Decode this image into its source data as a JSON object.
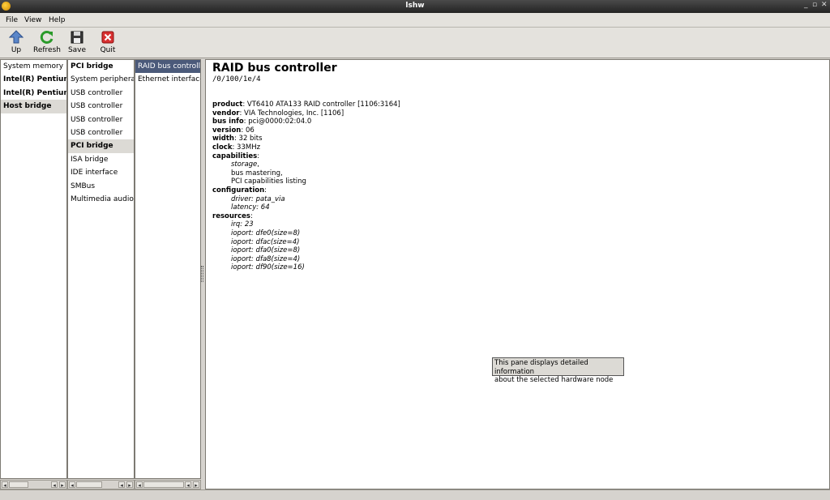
{
  "window": {
    "title": "lshw",
    "controls": [
      "_",
      "▫",
      "✕"
    ]
  },
  "menu": {
    "file": "File",
    "view": "View",
    "help": "Help"
  },
  "toolbar": {
    "up": "Up",
    "refresh": "Refresh",
    "save": "Save",
    "quit": "Quit",
    "icons": {
      "up": "up-arrow-icon",
      "refresh": "refresh-icon",
      "save": "floppy-icon",
      "quit": "quit-icon"
    }
  },
  "columns": [
    {
      "items": [
        {
          "label": "System memory",
          "bold": false,
          "state": ""
        },
        {
          "label": "Intel(R) Pentium",
          "bold": true,
          "state": ""
        },
        {
          "label": "Intel(R) Pentium",
          "bold": true,
          "state": ""
        },
        {
          "label": "Host bridge",
          "bold": true,
          "state": "sel"
        }
      ]
    },
    {
      "items": [
        {
          "label": "PCI bridge",
          "bold": true,
          "state": ""
        },
        {
          "label": "System peripheral",
          "bold": false,
          "state": ""
        },
        {
          "label": "USB controller",
          "bold": false,
          "state": ""
        },
        {
          "label": "USB controller",
          "bold": false,
          "state": ""
        },
        {
          "label": "USB controller",
          "bold": false,
          "state": ""
        },
        {
          "label": "USB controller",
          "bold": false,
          "state": ""
        },
        {
          "label": "PCI bridge",
          "bold": true,
          "state": "sel"
        },
        {
          "label": "ISA bridge",
          "bold": false,
          "state": ""
        },
        {
          "label": "IDE interface",
          "bold": false,
          "state": ""
        },
        {
          "label": "SMBus",
          "bold": false,
          "state": ""
        },
        {
          "label": "Multimedia audio c",
          "bold": false,
          "state": ""
        }
      ]
    },
    {
      "items": [
        {
          "label": "RAID bus controller",
          "bold": false,
          "state": "active"
        },
        {
          "label": "Ethernet interface",
          "bold": false,
          "state": ""
        }
      ]
    }
  ],
  "detail": {
    "title": "RAID bus controller",
    "path": "/0/100/1e/4",
    "properties": [
      {
        "key": "product",
        "value": ": VT6410 ATA133 RAID controller [1106:3164]"
      },
      {
        "key": "vendor",
        "value": ": VIA Technologies, Inc. [1106]"
      },
      {
        "key": "bus info",
        "value": ": pci@0000:02:04.0"
      },
      {
        "key": "version",
        "value": ": 06"
      },
      {
        "key": "width",
        "value": ": 32 bits"
      },
      {
        "key": "clock",
        "value": ": 33MHz"
      },
      {
        "key": "capabilities",
        "value": ":"
      }
    ],
    "capabilities": [
      {
        "text": "storage",
        "italic": true,
        "suffix": ","
      },
      {
        "text": "bus mastering,",
        "italic": false,
        "suffix": ""
      },
      {
        "text": "PCI capabilities listing",
        "italic": false,
        "suffix": ""
      }
    ],
    "configuration_label": "configuration",
    "configuration": [
      "driver: pata_via",
      "latency: 64"
    ],
    "resources_label": "resources",
    "resources": [
      "irq: 23",
      "ioport: dfe0(size=8)",
      "ioport: dfac(size=4)",
      "ioport: dfa0(size=8)",
      "ioport: dfa8(size=4)",
      "ioport: df90(size=16)"
    ]
  },
  "tooltip": {
    "line1": "This pane displays detailed information",
    "line2": "about the selected hardware node"
  }
}
